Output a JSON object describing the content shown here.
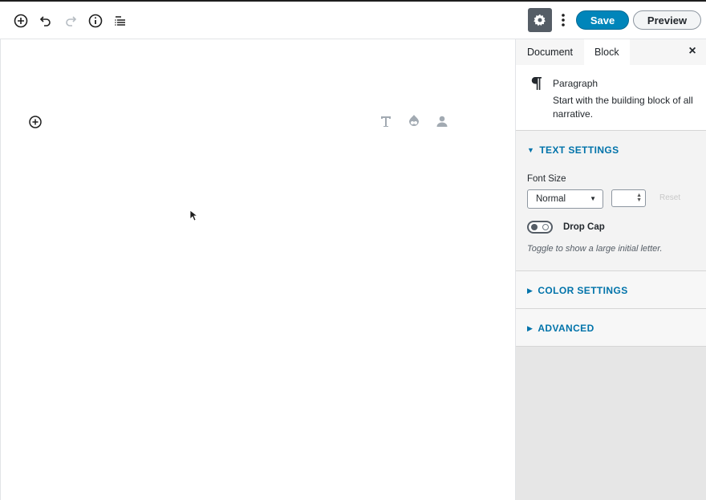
{
  "toolbar": {
    "left_icons": [
      "add-block-icon",
      "undo-icon",
      "redo-icon",
      "info-icon",
      "outline-icon"
    ],
    "save_label": "Save",
    "preview_label": "Preview"
  },
  "editor": {
    "block_icons": [
      "heading-icon",
      "drupal-icon",
      "user-icon"
    ]
  },
  "sidebar": {
    "tabs": [
      {
        "label": "Document"
      },
      {
        "label": "Block"
      }
    ],
    "close": "×",
    "block_card": {
      "title": "Paragraph",
      "description": "Start with the building block of all narrative."
    },
    "text_settings": {
      "title": "TEXT SETTINGS",
      "font_size_label": "Font Size",
      "font_size_value": "Normal",
      "reset_label": "Reset",
      "drop_cap_label": "Drop Cap",
      "drop_cap_help": "Toggle to show a large initial letter."
    },
    "color_settings": {
      "title": "COLOR SETTINGS"
    },
    "advanced": {
      "title": "ADVANCED"
    }
  },
  "colors": {
    "primary": "#0085ba",
    "link": "#0073aa"
  }
}
